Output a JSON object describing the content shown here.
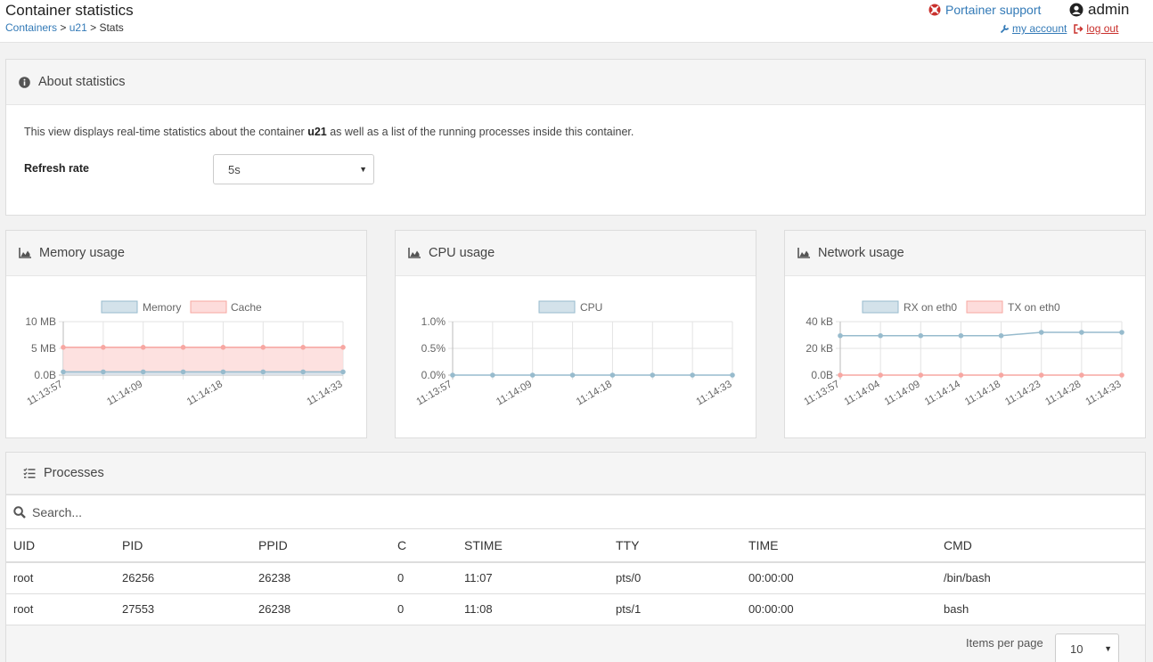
{
  "header": {
    "title": "Container statistics",
    "breadcrumb": {
      "containers": "Containers",
      "sep1": " > ",
      "container": "u21",
      "sep2": " > ",
      "current": "Stats"
    },
    "support": "Portainer support",
    "username": "admin",
    "my_account": "my account",
    "log_out": "log out"
  },
  "about": {
    "title": "About statistics",
    "text_before": "This view displays real-time statistics about the container ",
    "container_name": "u21",
    "text_after": " as well as a list of the running processes inside this container.",
    "refresh_label": "Refresh rate",
    "refresh_value": "5s"
  },
  "panels": {
    "memory_title": "Memory usage",
    "cpu_title": "CPU usage",
    "network_title": "Network usage"
  },
  "processes": {
    "title": "Processes",
    "search_placeholder": "Search...",
    "columns": [
      "UID",
      "PID",
      "PPID",
      "C",
      "STIME",
      "TTY",
      "TIME",
      "CMD"
    ],
    "rows": [
      [
        "root",
        "26256",
        "26238",
        "0",
        "11:07",
        "pts/0",
        "00:00:00",
        "/bin/bash"
      ],
      [
        "root",
        "27553",
        "26238",
        "0",
        "11:08",
        "pts/1",
        "00:00:00",
        "bash"
      ]
    ],
    "items_per_page_label": "Items per page",
    "items_per_page_value": "10"
  },
  "colors": {
    "blue_fill": "#d3e2ea",
    "blue_line": "#97bbcd",
    "red_fill": "#fddcdb",
    "red_line": "#f7a7a2",
    "link": "#337ab7",
    "logout": "#c9302c"
  },
  "icons": {
    "support": "life-ring-icon",
    "user": "user-circle-icon",
    "my_account": "wrench-icon",
    "log_out": "sign-out-icon",
    "about": "info-circle-icon",
    "charts": "area-chart-icon",
    "processes": "tasks-icon",
    "search": "search-icon"
  },
  "chart_data": [
    {
      "type": "area",
      "legend": [
        "Memory",
        "Cache"
      ],
      "yticks": [
        "10 MB",
        "5 MB",
        "0.0B"
      ],
      "ylim": [
        0,
        10
      ],
      "x": [
        "11:13:57",
        "11:14:03",
        "11:14:09",
        "11:14:13",
        "11:14:18",
        "11:14:23",
        "11:14:28",
        "11:14:33"
      ],
      "xtick_labels": [
        "11:13:57",
        "11:14:09",
        "11:14:18",
        "11:14:33"
      ],
      "series": [
        {
          "name": "Memory",
          "values": [
            0.6,
            0.6,
            0.6,
            0.6,
            0.6,
            0.6,
            0.6,
            0.6
          ]
        },
        {
          "name": "Cache",
          "values": [
            5.2,
            5.2,
            5.2,
            5.2,
            5.2,
            5.2,
            5.2,
            5.2
          ]
        }
      ],
      "grid": true
    },
    {
      "type": "line",
      "legend": [
        "CPU"
      ],
      "yticks": [
        "1.0%",
        "0.5%",
        "0.0%"
      ],
      "ylim": [
        0,
        1
      ],
      "x": [
        "11:13:57",
        "11:14:03",
        "11:14:09",
        "11:14:13",
        "11:14:18",
        "11:14:23",
        "11:14:28",
        "11:14:33"
      ],
      "xtick_labels": [
        "11:13:57",
        "11:14:09",
        "11:14:18",
        "11:14:33"
      ],
      "series": [
        {
          "name": "CPU",
          "values": [
            0,
            0,
            0,
            0,
            0,
            0,
            0,
            0
          ]
        }
      ],
      "grid": true
    },
    {
      "type": "line",
      "legend": [
        "RX on eth0",
        "TX on eth0"
      ],
      "yticks": [
        "40 kB",
        "20 kB",
        "0.0B"
      ],
      "ylim": [
        0,
        40
      ],
      "x": [
        "11:13:57",
        "11:14:04",
        "11:14:09",
        "11:14:14",
        "11:14:18",
        "11:14:23",
        "11:14:28",
        "11:14:33"
      ],
      "xtick_labels": [
        "11:13:57",
        "11:14:04",
        "11:14:09",
        "11:14:14",
        "11:14:18",
        "11:14:23",
        "11:14:28",
        "11:14:33"
      ],
      "series": [
        {
          "name": "RX on eth0",
          "values": [
            29.5,
            29.5,
            29.5,
            29.5,
            29.5,
            32,
            32,
            32
          ]
        },
        {
          "name": "TX on eth0",
          "values": [
            0,
            0,
            0,
            0,
            0,
            0,
            0,
            0
          ]
        }
      ],
      "grid": true
    }
  ]
}
